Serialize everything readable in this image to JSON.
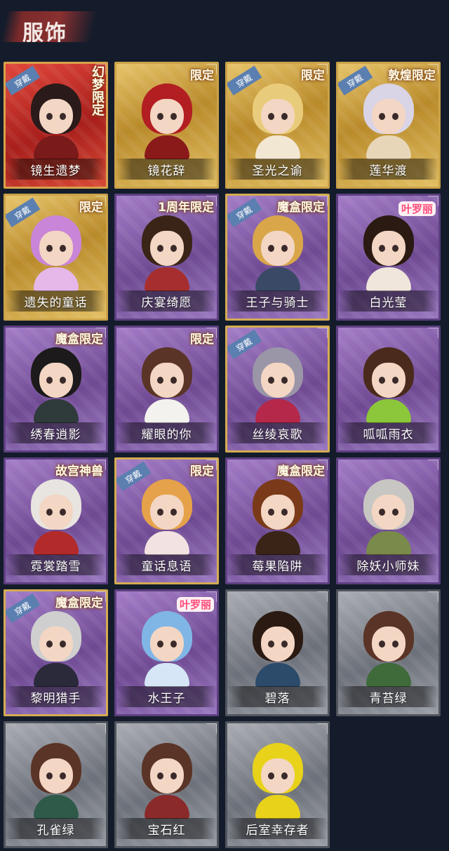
{
  "header": {
    "title": "服饰"
  },
  "costumes": [
    {
      "name": "镜生遗梦",
      "frame": "red",
      "worn_label": "穿戴",
      "tag": "幻梦限定",
      "tag_style": "vertical",
      "hair": "#2b1a1a",
      "outfit": "#7a1a1a"
    },
    {
      "name": "镜花辞",
      "frame": "gold",
      "worn_label": "",
      "tag": "限定",
      "tag_style": "normal",
      "hair": "#b21e22",
      "outfit": "#8a1a1a"
    },
    {
      "name": "圣光之谕",
      "frame": "gold",
      "worn_label": "穿戴",
      "tag": "限定",
      "tag_style": "normal",
      "hair": "#e9cc7b",
      "outfit": "#f2e7d2"
    },
    {
      "name": "莲华渡",
      "frame": "gold",
      "worn_label": "穿戴",
      "tag": "敦煌限定",
      "tag_style": "normal",
      "hair": "#d9d4e6",
      "outfit": "#e8d6b8"
    },
    {
      "name": "遗失的童话",
      "frame": "gold",
      "worn_label": "穿戴",
      "tag": "限定",
      "tag_style": "normal",
      "hair": "#c985d8",
      "outfit": "#e6b8ea"
    },
    {
      "name": "庆宴绮愿",
      "frame": "purple",
      "worn_label": "",
      "tag": "1周年限定",
      "tag_style": "normal",
      "hair": "#3a2418",
      "outfit": "#a62e2e"
    },
    {
      "name": "王子与骑士",
      "frame": "goldpurple",
      "worn_label": "穿戴",
      "tag": "魔盒限定",
      "tag_style": "normal",
      "hair": "#d9a74a",
      "outfit": "#3a4a66"
    },
    {
      "name": "白光莹",
      "frame": "purple",
      "worn_label": "",
      "tag": "叶罗丽",
      "tag_style": "pink",
      "hair": "#2a1a12",
      "outfit": "#f0e6dc"
    },
    {
      "name": "绣春逍影",
      "frame": "purple",
      "worn_label": "",
      "tag": "魔盒限定",
      "tag_style": "normal",
      "hair": "#1c1a1a",
      "outfit": "#2f3a3a"
    },
    {
      "name": "耀眼的你",
      "frame": "purple",
      "worn_label": "",
      "tag": "限定",
      "tag_style": "normal",
      "hair": "#5a3426",
      "outfit": "#f4f2ee"
    },
    {
      "name": "丝绫哀歌",
      "frame": "goldpurple",
      "worn_label": "穿戴",
      "tag": "",
      "tag_style": "normal",
      "hair": "#9a96a8",
      "outfit": "#b5284a"
    },
    {
      "name": "呱呱雨衣",
      "frame": "purple",
      "worn_label": "",
      "tag": "",
      "tag_style": "normal",
      "hair": "#4a2a1c",
      "outfit": "#8cc63a"
    },
    {
      "name": "霓裳踏雪",
      "frame": "purple",
      "worn_label": "",
      "tag": "故宫神兽",
      "tag_style": "normal",
      "hair": "#e8e4e0",
      "outfit": "#b22a2a"
    },
    {
      "name": "童话息语",
      "frame": "goldpurple",
      "worn_label": "穿戴",
      "tag": "限定",
      "tag_style": "normal",
      "hair": "#e6a24a",
      "outfit": "#f2e2e2"
    },
    {
      "name": "莓果陷阱",
      "frame": "purple",
      "worn_label": "",
      "tag": "魔盒限定",
      "tag_style": "normal",
      "hair": "#7a3a1a",
      "outfit": "#3a2418"
    },
    {
      "name": "除妖小师妹",
      "frame": "purple",
      "worn_label": "",
      "tag": "",
      "tag_style": "normal",
      "hair": "#c8c6c2",
      "outfit": "#7a8a4a"
    },
    {
      "name": "黎明猎手",
      "frame": "goldpurple",
      "worn_label": "穿戴",
      "tag": "魔盒限定",
      "tag_style": "normal",
      "hair": "#cfcfcf",
      "outfit": "#2a2a3a"
    },
    {
      "name": "水王子",
      "frame": "purple",
      "worn_label": "",
      "tag": "叶罗丽",
      "tag_style": "pink",
      "hair": "#7fb6e6",
      "outfit": "#d6e6f6"
    },
    {
      "name": "碧落",
      "frame": "gray",
      "worn_label": "",
      "tag": "",
      "tag_style": "normal",
      "hair": "#2a1a12",
      "outfit": "#2c4a6a"
    },
    {
      "name": "青苔绿",
      "frame": "gray",
      "worn_label": "",
      "tag": "",
      "tag_style": "normal",
      "hair": "#5a3426",
      "outfit": "#3f6a3a"
    },
    {
      "name": "孔雀绿",
      "frame": "gray",
      "worn_label": "",
      "tag": "",
      "tag_style": "normal",
      "hair": "#5a3426",
      "outfit": "#2f5a4a"
    },
    {
      "name": "宝石红",
      "frame": "gray",
      "worn_label": "",
      "tag": "",
      "tag_style": "normal",
      "hair": "#5a3426",
      "outfit": "#8a2a2a"
    },
    {
      "name": "后室幸存者",
      "frame": "gray",
      "worn_label": "",
      "tag": "",
      "tag_style": "normal",
      "hair": "#e8d21a",
      "outfit": "#e8d21a"
    }
  ]
}
